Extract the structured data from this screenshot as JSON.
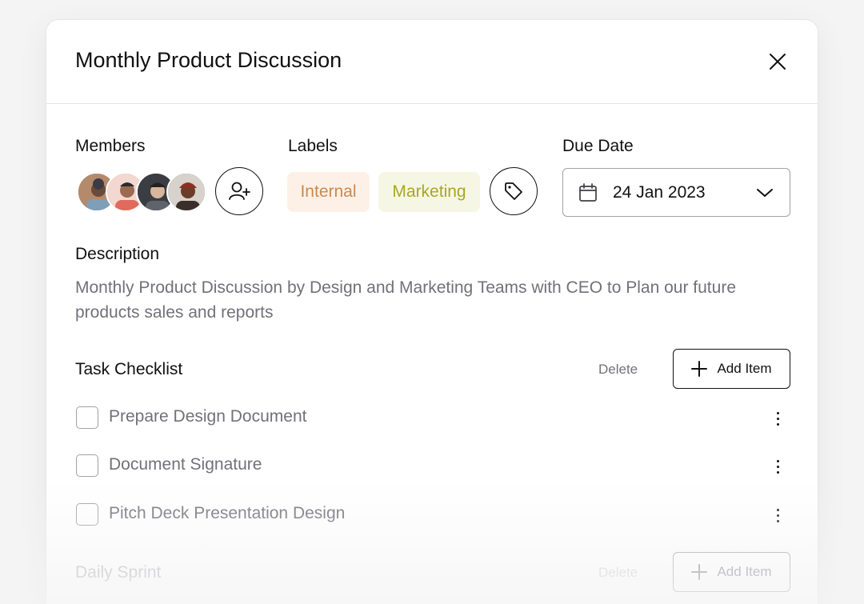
{
  "modal": {
    "title": "Monthly Product Discussion"
  },
  "members": {
    "label": "Members",
    "avatars": [
      "member-1",
      "member-2",
      "member-3",
      "member-4"
    ]
  },
  "labels": {
    "label": "Labels",
    "items": [
      {
        "text": "Internal",
        "bg": "#fdf1e7",
        "color": "#c98a4f"
      },
      {
        "text": "Marketing",
        "bg": "#f5f7e4",
        "color": "#a8a723"
      }
    ]
  },
  "due_date": {
    "label": "Due Date",
    "value": "24 Jan 2023"
  },
  "description": {
    "label": "Description",
    "text": "Monthly Product Discussion by Design and Marketing Teams with CEO to Plan our future products sales and reports"
  },
  "task_checklist": {
    "title": "Task Checklist",
    "delete_label": "Delete",
    "add_label": "Add Item",
    "tasks": [
      {
        "label": "Prepare Design Document",
        "checked": false
      },
      {
        "label": "Document Signature",
        "checked": false
      },
      {
        "label": "Pitch Deck Presentation Design",
        "checked": false
      }
    ]
  },
  "daily_sprint": {
    "title": "Daily Sprint",
    "delete_label": "Delete",
    "add_label": "Add Item"
  },
  "icons": [
    "close-icon",
    "add-user-icon",
    "tag-icon",
    "calendar-icon",
    "chevron-down-icon",
    "plus-icon",
    "more-vertical-icon"
  ]
}
